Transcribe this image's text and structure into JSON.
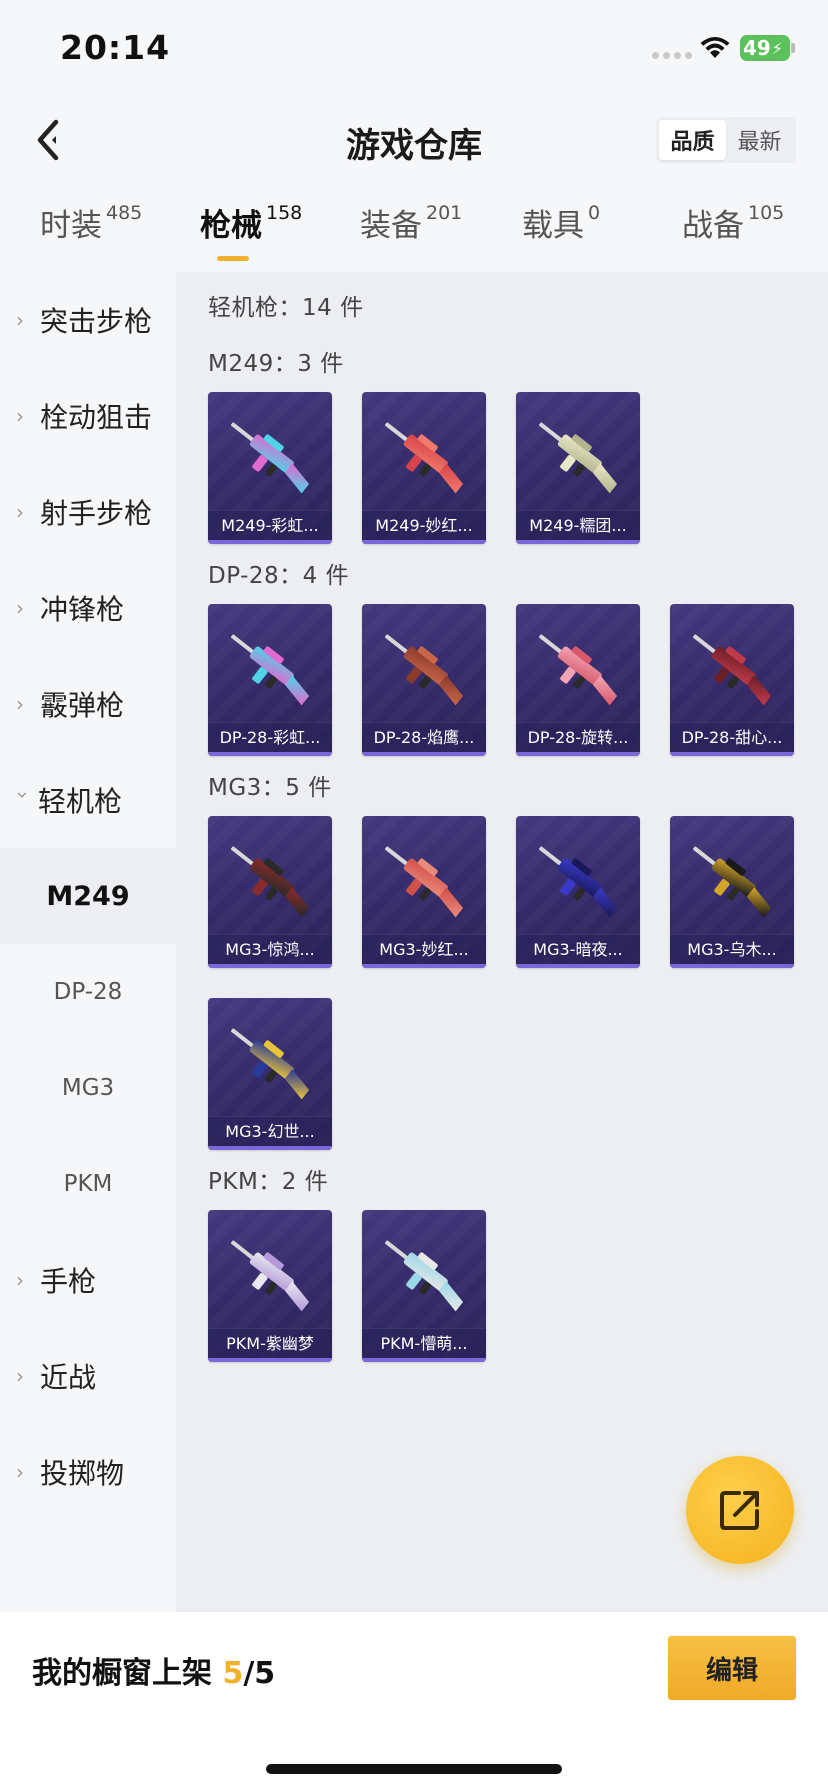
{
  "status_bar": {
    "time": "20:14",
    "battery": "49"
  },
  "header": {
    "title": "游戏仓库",
    "sort_options": [
      "品质",
      "最新"
    ],
    "back_icon": "chevron-left-icon"
  },
  "tabs": [
    {
      "label": "时装",
      "count": "485"
    },
    {
      "label": "枪械",
      "count": "158"
    },
    {
      "label": "装备",
      "count": "201"
    },
    {
      "label": "载具",
      "count": "0"
    },
    {
      "label": "战备",
      "count": "105"
    }
  ],
  "sidebar": {
    "categories": [
      {
        "label": "突击步枪",
        "expanded": false
      },
      {
        "label": "栓动狙击",
        "expanded": false
      },
      {
        "label": "射手步枪",
        "expanded": false
      },
      {
        "label": "冲锋枪",
        "expanded": false
      },
      {
        "label": "霰弹枪",
        "expanded": false
      },
      {
        "label": "轻机枪",
        "expanded": true
      }
    ],
    "subcategories": [
      "M249",
      "DP-28",
      "MG3",
      "PKM"
    ],
    "active_subcategory": "M249",
    "more_categories": [
      {
        "label": "手枪"
      },
      {
        "label": "近战"
      },
      {
        "label": "投掷物"
      }
    ]
  },
  "content": {
    "summary": "轻机枪：14 件",
    "groups": [
      {
        "title": "M249：3 件",
        "items": [
          {
            "label": "M249-彩虹...",
            "colors": [
              "#e06ad0",
              "#4fd3e6"
            ]
          },
          {
            "label": "M249-妙红...",
            "colors": [
              "#d8434a",
              "#f07a6a"
            ]
          },
          {
            "label": "M249-糯团...",
            "colors": [
              "#e8e8c8",
              "#b4b48c"
            ]
          }
        ]
      },
      {
        "title": "DP-28：4 件",
        "items": [
          {
            "label": "DP-28-彩虹...",
            "colors": [
              "#4fd3e6",
              "#e06ad0"
            ]
          },
          {
            "label": "DP-28-焰鹰...",
            "colors": [
              "#8a3a2a",
              "#c9664a"
            ]
          },
          {
            "label": "DP-28-旋转...",
            "colors": [
              "#f2a3b4",
              "#d85a6a"
            ]
          },
          {
            "label": "DP-28-甜心...",
            "colors": [
              "#6a1e28",
              "#c23a4a"
            ]
          }
        ]
      },
      {
        "title": "MG3：5 件",
        "items": [
          {
            "label": "MG3-惊鸿...",
            "colors": [
              "#8a2a2a",
              "#2a2a2a"
            ]
          },
          {
            "label": "MG3-妙红...",
            "colors": [
              "#d2504a",
              "#e88a7a"
            ]
          },
          {
            "label": "MG3-暗夜...",
            "colors": [
              "#3a3ac8",
              "#1a1a5a"
            ]
          },
          {
            "label": "MG3-乌木...",
            "colors": [
              "#d4a52a",
              "#1a1a1a"
            ]
          },
          {
            "label": "MG3-幻世...",
            "colors": [
              "#2a3a9a",
              "#e8c43a"
            ]
          }
        ]
      },
      {
        "title": "PKM：2 件",
        "items": [
          {
            "label": "PKM-紫幽梦",
            "colors": [
              "#e8e8f0",
              "#b49ad8"
            ]
          },
          {
            "label": "PKM-懵萌...",
            "colors": [
              "#9ad8e8",
              "#e8e8e8"
            ]
          }
        ]
      }
    ]
  },
  "share_icon": "share-export-icon",
  "bottom_bar": {
    "showcase_label": "我的橱窗上架",
    "showcase_current": "5",
    "showcase_total": "/5",
    "edit_label": "编辑"
  }
}
